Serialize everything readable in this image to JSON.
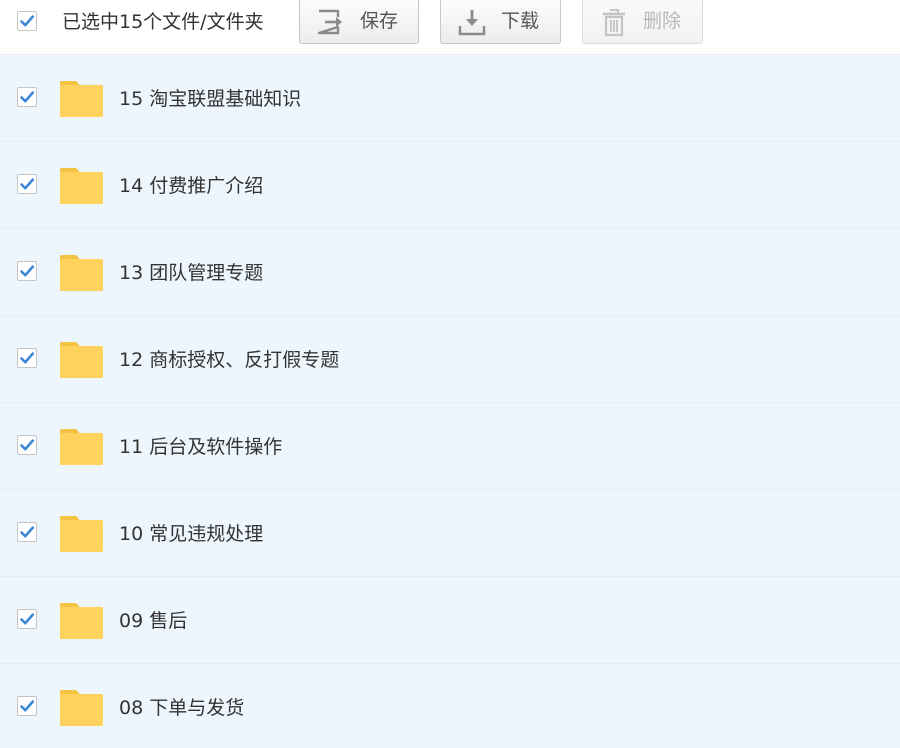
{
  "toolbar": {
    "selection_text": "已选中15个文件/文件夹",
    "select_all_checked": true,
    "save_label": "保存",
    "download_label": "下载",
    "delete_label": "删除"
  },
  "colors": {
    "check_blue": "#3b86d6",
    "folder_yellow": "#ffd25e",
    "row_background": "#eef6fd"
  },
  "files": [
    {
      "name": "15 淘宝联盟基础知识",
      "checked": true,
      "icon": "folder-icon"
    },
    {
      "name": "14 付费推广介绍",
      "checked": true,
      "icon": "folder-icon"
    },
    {
      "name": "13 团队管理专题",
      "checked": true,
      "icon": "folder-icon"
    },
    {
      "name": "12 商标授权、反打假专题",
      "checked": true,
      "icon": "folder-icon"
    },
    {
      "name": "11 后台及软件操作",
      "checked": true,
      "icon": "folder-icon"
    },
    {
      "name": "10 常见违规处理",
      "checked": true,
      "icon": "folder-icon"
    },
    {
      "name": "09 售后",
      "checked": true,
      "icon": "folder-icon"
    },
    {
      "name": "08 下单与发货",
      "checked": true,
      "icon": "folder-icon"
    }
  ]
}
